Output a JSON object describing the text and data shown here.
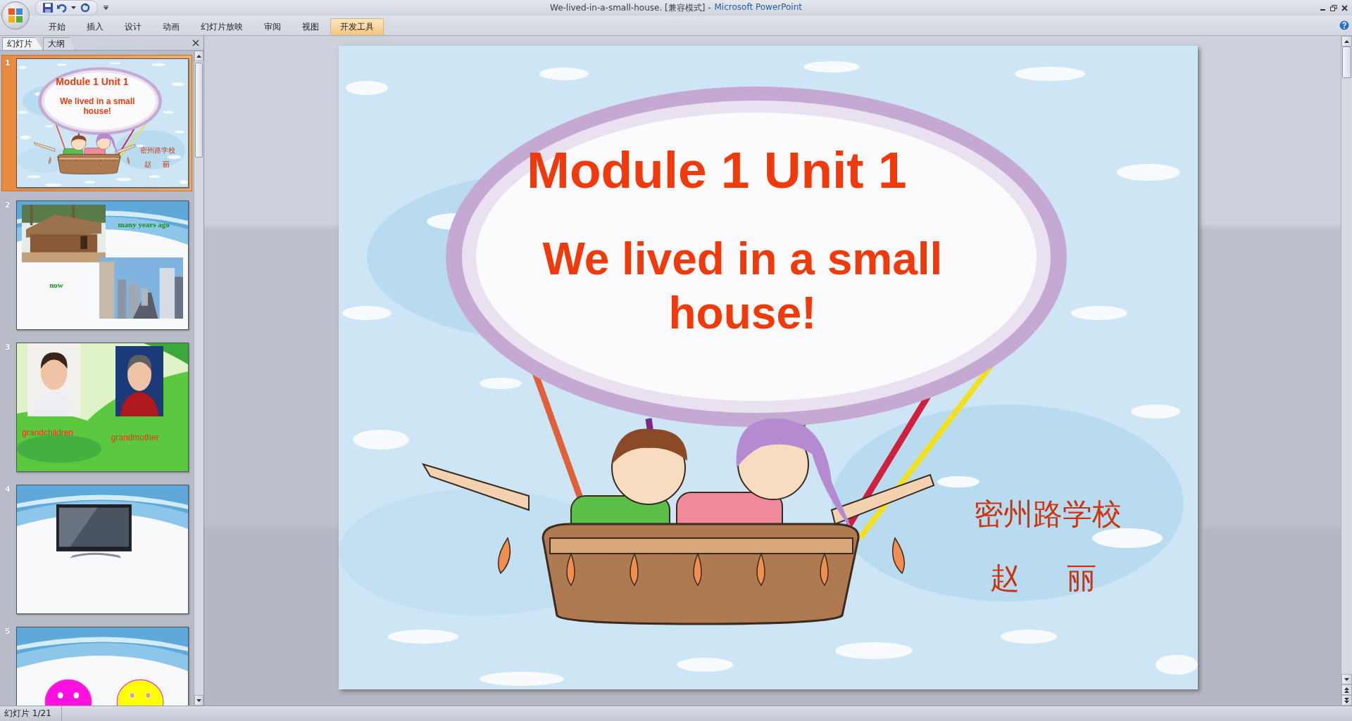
{
  "window": {
    "title": "We-lived-in-a-small-house. [兼容模式] -",
    "app_name": "Microsoft PowerPoint"
  },
  "ribbon_tabs": [
    {
      "label": "开始",
      "selected": false
    },
    {
      "label": "插入",
      "selected": false
    },
    {
      "label": "设计",
      "selected": false
    },
    {
      "label": "动画",
      "selected": false
    },
    {
      "label": "幻灯片放映",
      "selected": false
    },
    {
      "label": "审阅",
      "selected": false
    },
    {
      "label": "视图",
      "selected": false
    },
    {
      "label": "开发工具",
      "selected": true
    }
  ],
  "panel_tabs": [
    {
      "label": "幻灯片",
      "selected": true
    },
    {
      "label": "大纲",
      "selected": false
    }
  ],
  "slides": [
    {
      "number": "1",
      "selected": true,
      "kind": "title",
      "heading": "Module 1 Unit 1",
      "subtitle": "We lived in a small house!",
      "school": "密州路学校",
      "author": "赵　丽"
    },
    {
      "number": "2",
      "selected": false,
      "kind": "then-now",
      "captions": [
        "many years ago",
        "now"
      ]
    },
    {
      "number": "3",
      "selected": false,
      "kind": "family",
      "captions": [
        "grandchildren",
        "grandmother"
      ]
    },
    {
      "number": "4",
      "selected": false,
      "kind": "tv"
    },
    {
      "number": "5",
      "selected": false,
      "kind": "smileys"
    }
  ],
  "current_slide": {
    "heading": "Module 1 Unit 1",
    "subtitle": "We lived in a small house!",
    "school": "密州路学校",
    "author": "赵　丽"
  },
  "status_bar": {
    "slide_counter": "幻灯片 1/21"
  }
}
